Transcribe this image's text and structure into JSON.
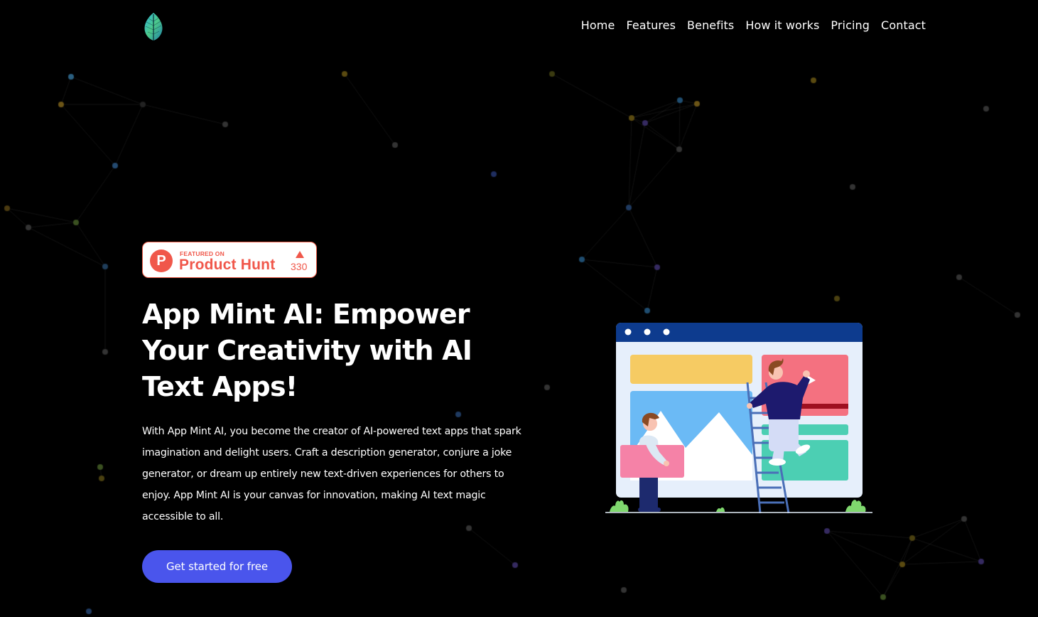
{
  "brand": {
    "logo_icon": "leaf-icon",
    "logo_gradient": [
      "#2fb6d8",
      "#4cc98a",
      "#1f7fa6"
    ]
  },
  "nav": {
    "items": [
      {
        "label": "Home"
      },
      {
        "label": "Features"
      },
      {
        "label": "Benefits"
      },
      {
        "label": "How it works"
      },
      {
        "label": "Pricing"
      },
      {
        "label": "Contact"
      }
    ]
  },
  "product_hunt": {
    "icon": "product-hunt-icon",
    "logo_letter": "P",
    "featured_label": "FEATURED ON",
    "name": "Product Hunt",
    "upvote_icon": "triangle-up-icon",
    "upvotes": "330",
    "color": "#f0574a"
  },
  "hero": {
    "title": "App Mint AI: Empower Your Creativity with AI Text Apps!",
    "description": "With App Mint AI, you become the creator of AI-powered text apps that spark imagination and delight users. Craft a description generator, conjure a joke generator, or dream up entirely new text-driven experiences for others to enjoy. App Mint AI is your canvas for innovation, making AI text magic accessible to all.",
    "cta_label": "Get started for free",
    "cta_color": "#4a55ec"
  },
  "illustration": {
    "name": "website-builder-illustration",
    "colors": {
      "window_bar": "#0d3b8e",
      "window_body": "#e6effb",
      "yellow_block": "#f6cb63",
      "red_block": "#f47180",
      "blue_image": "#6bbaf5",
      "green_block": "#4ccfb3",
      "pink_panel": "#f582a7",
      "ladder": "#4a6fb7",
      "sweater": "#1d1a6e",
      "plant": "#7fd86e"
    }
  }
}
